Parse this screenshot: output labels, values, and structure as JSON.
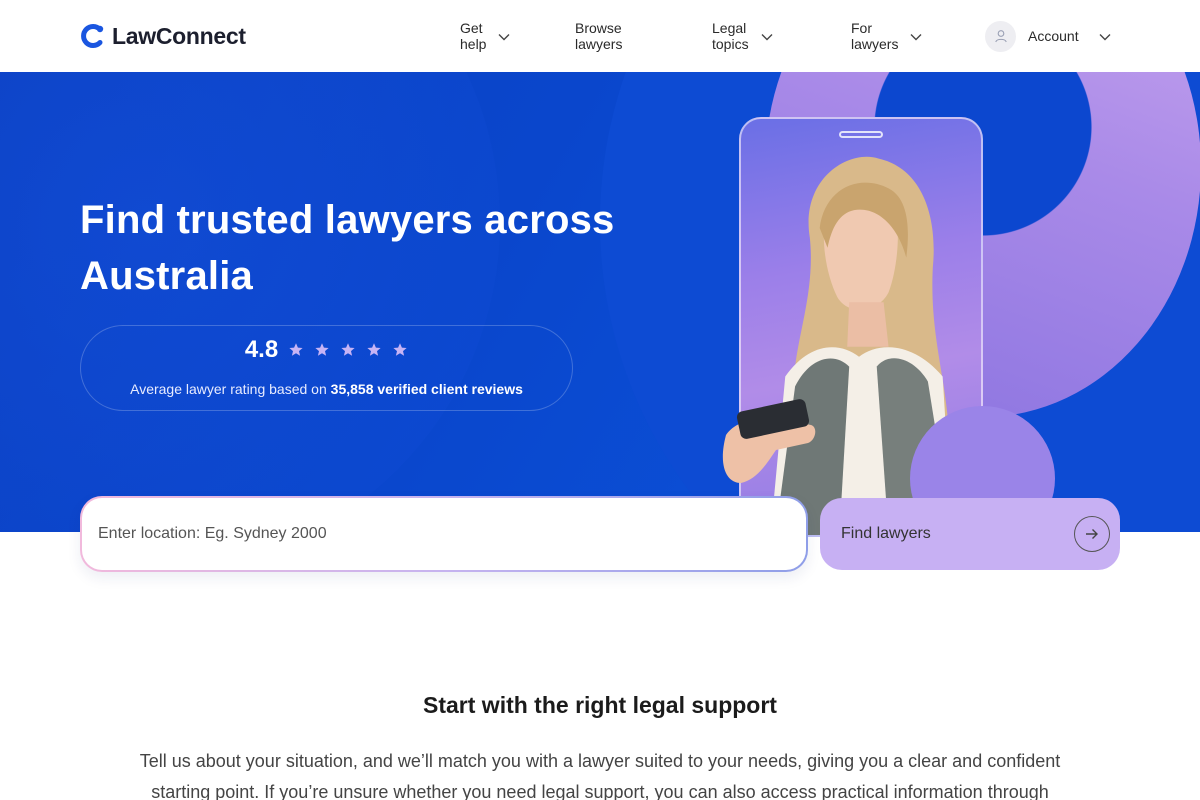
{
  "brand": {
    "name": "LawConnect",
    "accent": "#1a4fd6"
  },
  "nav": {
    "get_help": "Get help",
    "browse_lawyers": "Browse lawyers",
    "legal_topics": "Legal topics",
    "for_lawyers": "For lawyers",
    "account": "Account"
  },
  "hero": {
    "title": "Find trusted lawyers across Australia",
    "rating": {
      "score": "4.8",
      "stars": 5,
      "sub_prefix": "Average lawyer rating based on ",
      "sub_bold": "35,858 verified client reviews"
    }
  },
  "search": {
    "placeholder": "Enter location: Eg. Sydney 2000",
    "button_label": "Find lawyers"
  },
  "section": {
    "title": "Start with the right legal support",
    "body": "Tell us about your situation, and we’ll match you with a lawyer suited to your needs, giving you a clear and confident starting point. If you’re unsure whether you need legal support, you can also access practical information through"
  }
}
